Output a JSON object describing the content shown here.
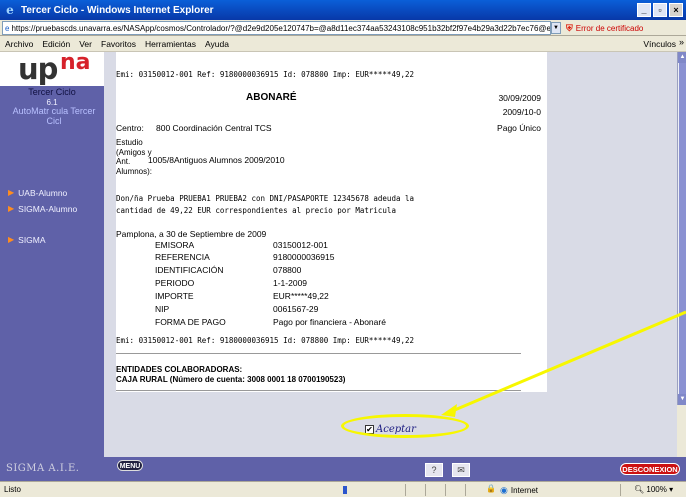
{
  "window": {
    "title": "Tercer Ciclo - Windows Internet Explorer",
    "buttons": {
      "minimize": "_",
      "maximize": "▫",
      "close": "×"
    }
  },
  "address": {
    "url": "https://pruebascds.unavarra.es/NASApp/cosmos/Controlador/?@d2e9d205e120747b=@a8d11ec374aa53243108c951b32bf2f97e4b29a3d22b7ec76@ebf2f349580da806=@27f",
    "cert_error": "Error de certificado"
  },
  "menu": {
    "items": [
      "Archivo",
      "Edición",
      "Ver",
      "Favoritos",
      "Herramientas",
      "Ayuda"
    ],
    "links_label": "Vínculos",
    "more": "»"
  },
  "sidebar": {
    "logo_up": "up",
    "logo_na": "na",
    "ciclo": "Tercer Ciclo",
    "version": "6.1",
    "app_link": "AutoMatr cula Tercer Cicl",
    "items": [
      {
        "label": "UAB-Alumno"
      },
      {
        "label": "SIGMA-Alumno"
      },
      {
        "label": "SIGMA"
      }
    ]
  },
  "document": {
    "ref_line": "Emi: 03150012-001 Ref: 9180000036915 Id: 078800 Imp: EUR*****49,22",
    "title": "ABONARÉ",
    "date": "30/09/2009",
    "number": "2009/10-0",
    "pago": "Pago Único",
    "centro_label": "Centro:",
    "centro_value": "800 Coordinación Central TCS",
    "estudio_label": "Estudio (Amigos y Ant. Alumnos):",
    "estudio_value": "1005/8Antiguos Alumnos 2009/2010",
    "paragraph_line1": "Don/ña  Prueba  PRUEBA1  PRUEBA2  con DNI/PASAPORTE 12345678 adeuda la",
    "paragraph_line2": "cantidad de 49,22 EUR correspondientes al precio por Matricula",
    "pamplona": "Pamplona, a 30 de Septiembre de 2009",
    "fields": [
      {
        "key": "EMISORA",
        "value": "03150012-001"
      },
      {
        "key": "REFERENCIA",
        "value": "9180000036915"
      },
      {
        "key": "IDENTIFICACIÓN",
        "value": "078800"
      },
      {
        "key": "PERIODO",
        "value": "1-1-2009"
      },
      {
        "key": "IMPORTE",
        "value": "EUR*****49,22"
      },
      {
        "key": "NIP",
        "value": "0061567-29"
      },
      {
        "key": "FORMA DE PAGO",
        "value": "Pago por financiera - Abonaré"
      }
    ],
    "entidades_title": "ENTIDADES COLABORADORAS:",
    "entidades_value": "CAJA RURAL (Número de cuenta: 3008 0001 18 0700190523)",
    "accept_label": "Aceptar",
    "accept_checked": "✔"
  },
  "bottombar": {
    "brand": "SIGMA A.I.E.",
    "menu": "MENU",
    "help": "?",
    "mail": "✉",
    "logout": "DESCONEXION"
  },
  "status": {
    "text": "Listo",
    "zone": "Internet",
    "zoom": "100%",
    "zoom_arrow": "▾"
  },
  "colors": {
    "sidebar": "#5f61a8",
    "accent_red": "#d6222b",
    "highlight": "#f7f700"
  }
}
